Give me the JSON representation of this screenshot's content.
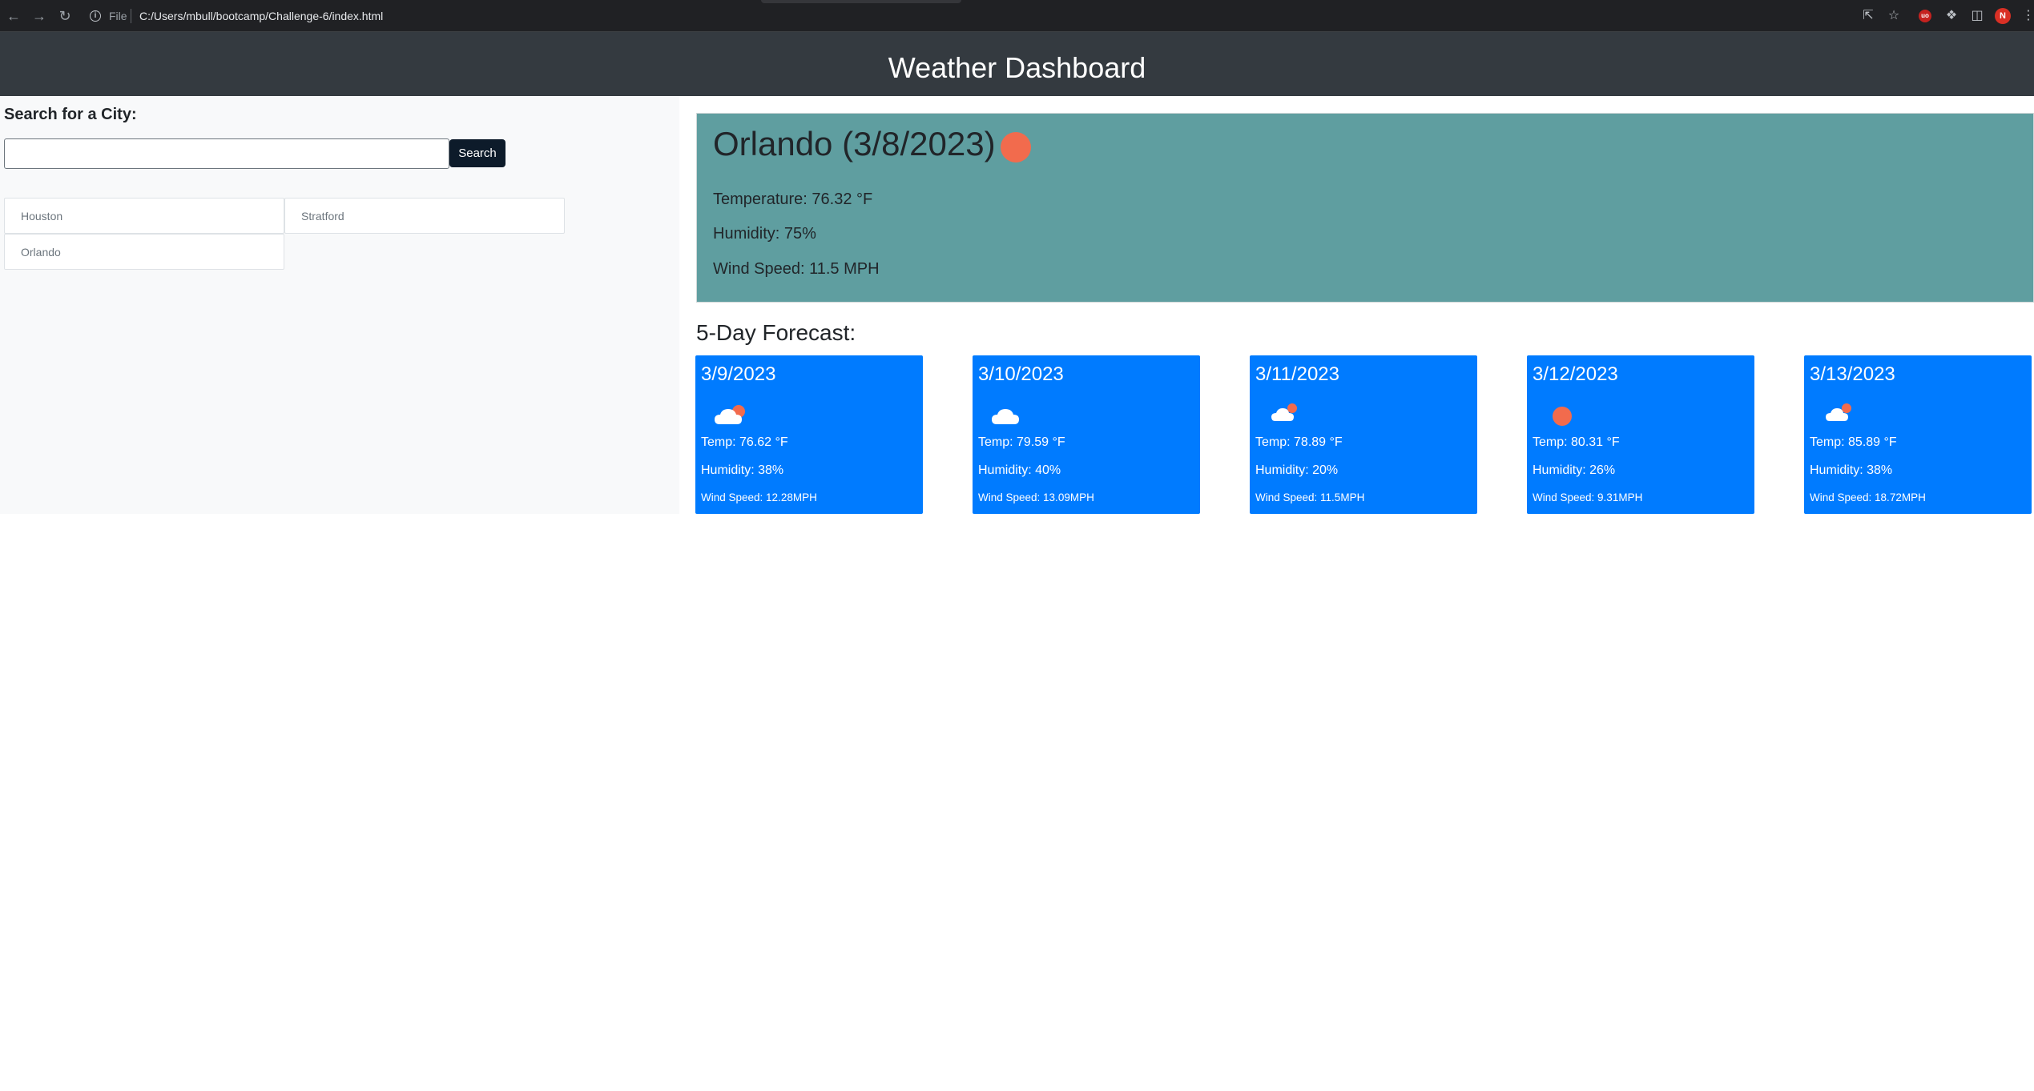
{
  "browser": {
    "file_label": "File",
    "url": "C:/Users/mbull/bootcamp/Challenge-6/index.html",
    "profile_initial": "N"
  },
  "header": {
    "title": "Weather Dashboard"
  },
  "search": {
    "label": "Search for a City:",
    "input_value": "",
    "button_label": "Search"
  },
  "history": [
    "Houston",
    "Stratford",
    "Orlando"
  ],
  "current": {
    "title": "Orlando (3/8/2023)",
    "icon": "sun-icon",
    "temperature": "Temperature: 76.32 °F",
    "humidity": "Humidity: 75%",
    "wind": "Wind Speed: 11.5 MPH"
  },
  "forecast": {
    "title": "5-Day Forecast:",
    "days": [
      {
        "date": "3/9/2023",
        "icon": "cloud-sun-icon",
        "temp": "Temp: 76.62 °F",
        "humidity": "Humidity: 38%",
        "wind": "Wind Speed: 12.28MPH"
      },
      {
        "date": "3/10/2023",
        "icon": "cloud-icon",
        "temp": "Temp: 79.59 °F",
        "humidity": "Humidity: 40%",
        "wind": "Wind Speed: 13.09MPH"
      },
      {
        "date": "3/11/2023",
        "icon": "cloud-sun-icon",
        "temp": "Temp: 78.89 °F",
        "humidity": "Humidity: 20%",
        "wind": "Wind Speed: 11.5MPH"
      },
      {
        "date": "3/12/2023",
        "icon": "sun-icon",
        "temp": "Temp: 80.31 °F",
        "humidity": "Humidity: 26%",
        "wind": "Wind Speed: 9.31MPH"
      },
      {
        "date": "3/13/2023",
        "icon": "cloud-sun-icon",
        "temp": "Temp: 85.89 °F",
        "humidity": "Humidity: 38%",
        "wind": "Wind Speed: 18.72MPH"
      }
    ]
  },
  "colors": {
    "header_bg": "#343a40",
    "current_bg": "#5f9ea0",
    "card_bg": "#007bff",
    "sun": "#f26b4d"
  }
}
